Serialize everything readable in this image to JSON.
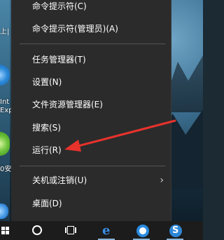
{
  "menu": {
    "items": [
      {
        "label": "命令提示符(C)"
      },
      {
        "label": "命令提示符(管理员)(A)"
      },
      {
        "label": "任务管理器(T)"
      },
      {
        "label": "设置(N)"
      },
      {
        "label": "文件资源管理器(E)"
      },
      {
        "label": "搜索(S)"
      },
      {
        "label": "运行(R)"
      },
      {
        "label": "关机或注销(U)"
      },
      {
        "label": "桌面(D)"
      }
    ],
    "submenu_icon": "chevron-right-icon",
    "submenu_glyph": "›"
  },
  "desktop": {
    "icon_text_1": "上|",
    "icon_text_2": "Int",
    "icon_text_3": "Exp",
    "icon_text_4": "0安"
  },
  "taskbar": {
    "items": [
      "windows-start-icon",
      "cortana-icon",
      "task-view-icon",
      "edge-browser-icon",
      "qq-browser-icon",
      "sogou-icon"
    ],
    "edge_glyph": "e"
  },
  "colors": {
    "menu_bg": "#2b2b2b",
    "arrow": "#e8322c",
    "taskbar_bg": "#1c1c1c"
  }
}
